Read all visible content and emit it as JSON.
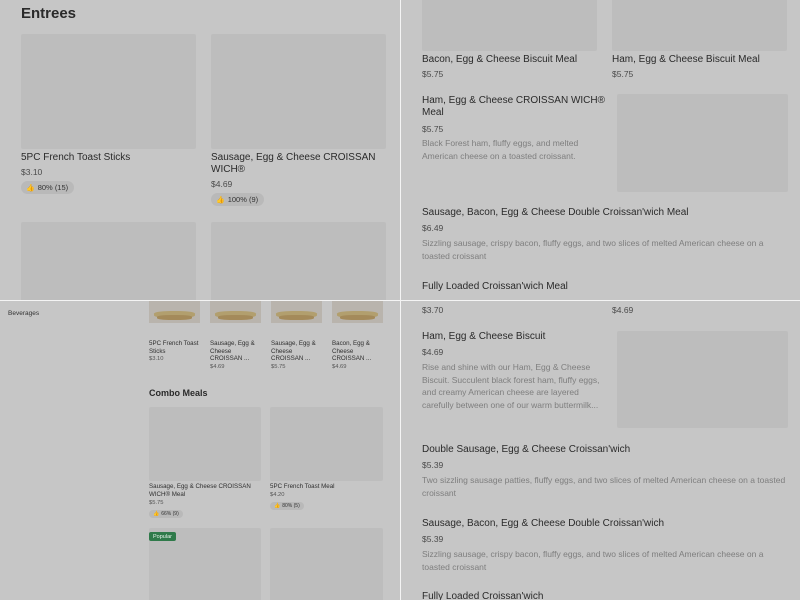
{
  "q1": {
    "section_title": "Entrees",
    "items": [
      {
        "name": "5PC French Toast Sticks",
        "price": "$3.10",
        "rating": "80% (15)"
      },
      {
        "name": "Sausage, Egg & Cheese CROISSAN WICH®",
        "price": "$4.69",
        "rating": "100% (9)"
      }
    ]
  },
  "q2": {
    "items": [
      {
        "name": "Bacon, Egg & Cheese Biscuit Meal",
        "price": "$5.75"
      },
      {
        "name": "Ham, Egg & Cheese Biscuit Meal",
        "price": "$5.75"
      }
    ],
    "list": [
      {
        "name": "Ham, Egg & Cheese CROISSAN WICH® Meal",
        "price": "$5.75",
        "desc": "Black Forest ham, fluffy eggs, and melted American cheese on a toasted croissant."
      },
      {
        "name": "Sausage, Bacon, Egg & Cheese Double Croissan'wich Meal",
        "price": "$6.49",
        "desc": "Sizzling sausage, crispy bacon, fluffy eggs, and two slices of melted American cheese on a toasted croissant"
      },
      {
        "name": "Fully Loaded Croissan'wich Meal",
        "price": ""
      }
    ]
  },
  "q3": {
    "sidebar_item": "Beverages",
    "small_items": [
      {
        "name": "5PC French Toast Sticks",
        "price": "$3.10"
      },
      {
        "name": "Sausage, Egg & Cheese CROISSAN ...",
        "price": "$4.69"
      },
      {
        "name": "Sausage, Egg & Cheese CROISSAN ...",
        "price": "$5.75"
      },
      {
        "name": "Bacon, Egg & Cheese CROISSAN ...",
        "price": "$4.69"
      }
    ],
    "section_title": "Combo Meals",
    "combo_items": [
      {
        "name": "Sausage, Egg & Cheese CROISSAN WICH® Meal",
        "price": "$5.75",
        "rating": "66% (9)"
      },
      {
        "name": "5PC French Toast Meal",
        "price": "$4.20",
        "rating": "80% (5)"
      }
    ],
    "badge": "Popular"
  },
  "q4": {
    "top_prices": [
      "$3.70",
      "$4.69"
    ],
    "list": [
      {
        "name": "Ham, Egg & Cheese Biscuit",
        "price": "$4.69",
        "desc": "Rise and shine with our Ham, Egg & Cheese Biscuit. Succulent black forest ham, fluffy eggs, and creamy American cheese are layered carefully between one of our warm buttermilk..."
      },
      {
        "name": "Double Sausage, Egg & Cheese Croissan'wich",
        "price": "$5.39",
        "desc": "Two sizzling sausage patties, fluffy eggs, and two slices of melted American cheese on a toasted croissant"
      },
      {
        "name": "Sausage, Bacon, Egg & Cheese Double Croissan'wich",
        "price": "$5.39",
        "desc": "Sizzling sausage, crispy bacon, fluffy eggs, and two slices of melted American cheese on a toasted croissant"
      },
      {
        "name": "Fully Loaded Croissan'wich",
        "price": ""
      }
    ]
  },
  "icons": {
    "thumb": "thumbs-up-icon"
  }
}
